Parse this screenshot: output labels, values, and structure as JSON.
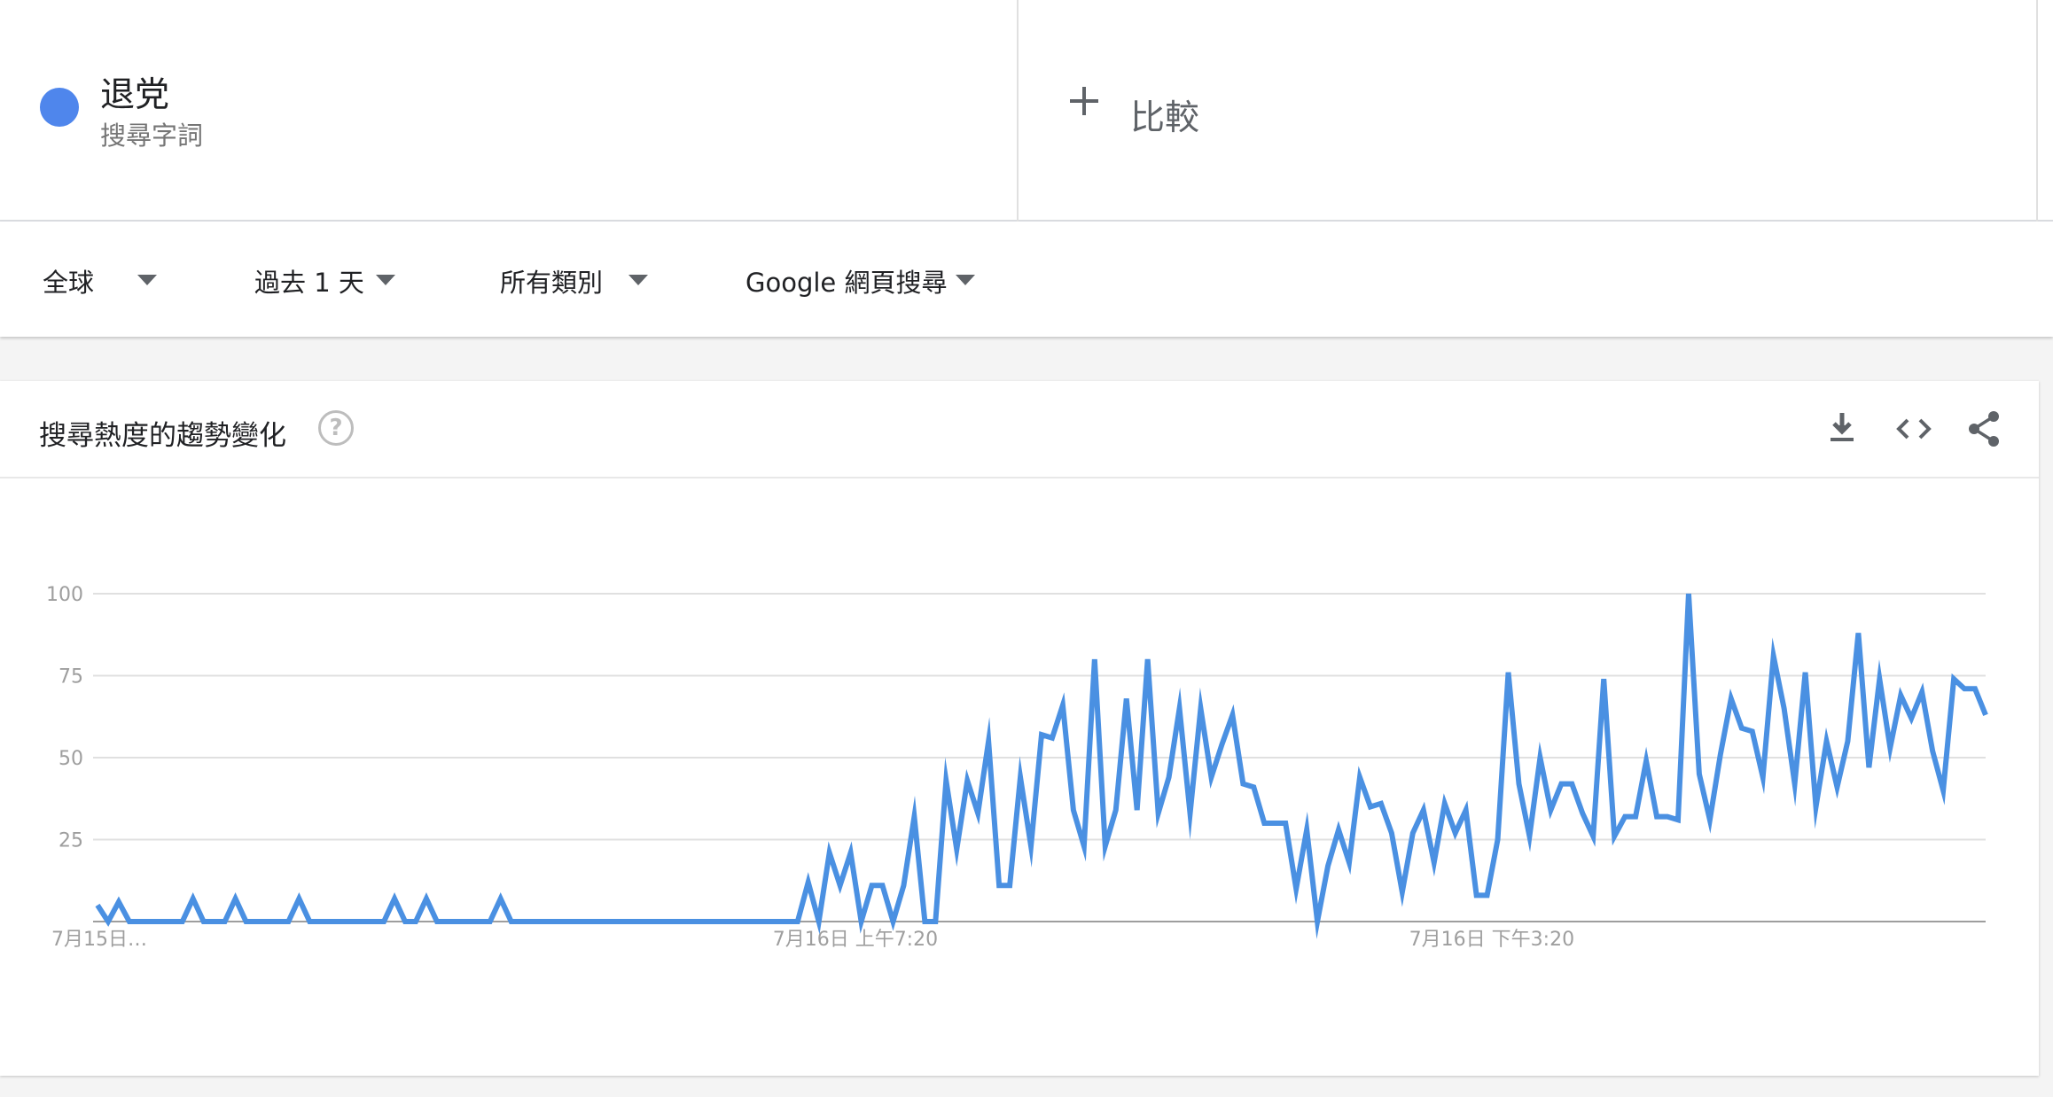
{
  "search_term": {
    "name": "退党",
    "type_label": "搜尋字詞",
    "color": "#4f86ec"
  },
  "compare": {
    "label": "比較",
    "icon": "plus-icon"
  },
  "filters": {
    "region": "全球",
    "time_range": "過去 1 天",
    "category": "所有類別",
    "search_type": "Google 網頁搜尋"
  },
  "card": {
    "title": "搜尋熱度的趨勢變化",
    "help_icon": "?",
    "actions": [
      "download-icon",
      "embed-icon",
      "share-icon"
    ]
  },
  "chart_data": {
    "type": "line",
    "title": "",
    "xlabel": "",
    "ylabel": "",
    "ylim": [
      0,
      100
    ],
    "yticks": [
      25,
      50,
      75,
      100
    ],
    "x_tick_labels": [
      {
        "index": 0,
        "label": "7月15日…"
      },
      {
        "index": 68,
        "label": "7月16日 上午7:20"
      },
      {
        "index": 128,
        "label": "7月16日 下午3:20"
      }
    ],
    "series": [
      {
        "color": "#4a90e2",
        "values": [
          5,
          0,
          6,
          0,
          0,
          0,
          0,
          0,
          0,
          7,
          0,
          0,
          0,
          7,
          0,
          0,
          0,
          0,
          0,
          7,
          0,
          0,
          0,
          0,
          0,
          0,
          0,
          0,
          7,
          0,
          0,
          7,
          0,
          0,
          0,
          0,
          0,
          0,
          7,
          0,
          0,
          0,
          0,
          0,
          0,
          0,
          0,
          0,
          0,
          0,
          0,
          0,
          0,
          0,
          0,
          0,
          0,
          0,
          0,
          0,
          0,
          0,
          0,
          0,
          0,
          0,
          0,
          12,
          0,
          21,
          11,
          21,
          0,
          11,
          11,
          0,
          11,
          32,
          0,
          0,
          43,
          22,
          43,
          33,
          55,
          11,
          11,
          44,
          23,
          57,
          56,
          66,
          34,
          23,
          80,
          23,
          34,
          68,
          34,
          80,
          33,
          44,
          65,
          33,
          65,
          44,
          54,
          63,
          42,
          41,
          30,
          30,
          30,
          10,
          28,
          0,
          17,
          28,
          18,
          44,
          35,
          36,
          27,
          9,
          27,
          34,
          18,
          36,
          27,
          34,
          8,
          8,
          25,
          76,
          42,
          26,
          50,
          34,
          42,
          42,
          33,
          26,
          74,
          26,
          32,
          32,
          49,
          32,
          32,
          31,
          100,
          45,
          31,
          51,
          68,
          59,
          58,
          44,
          81,
          65,
          42,
          76,
          35,
          55,
          41,
          55,
          88,
          47,
          74,
          53,
          69,
          62,
          70,
          52,
          40,
          74,
          71,
          71,
          63
        ]
      }
    ]
  }
}
